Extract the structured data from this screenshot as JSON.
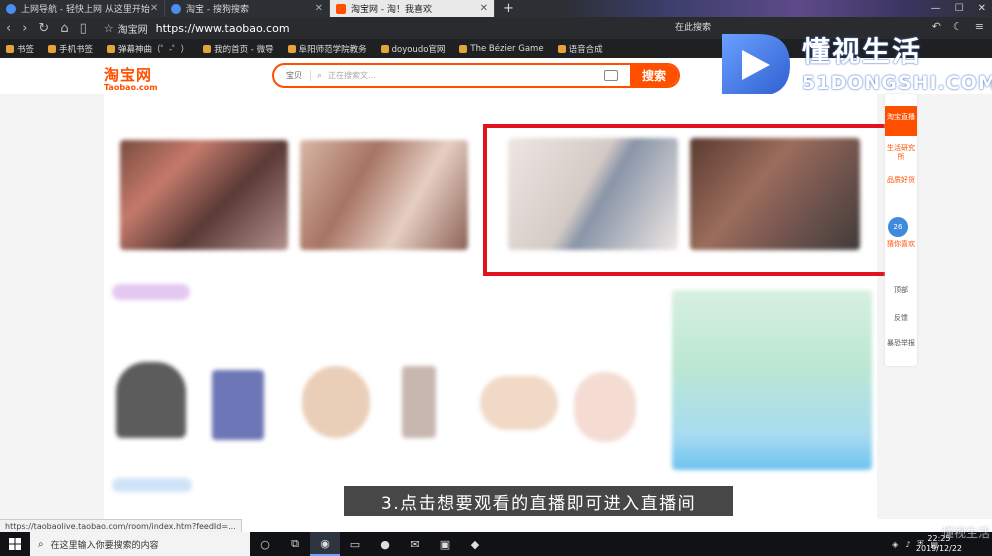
{
  "browser": {
    "tabs": [
      {
        "label": "上网导航 - 轻快上网 从这里开始",
        "active": false
      },
      {
        "label": "淘宝 - 搜狗搜索",
        "active": false
      },
      {
        "label": "淘宝网 - 淘！我喜欢",
        "active": true
      }
    ],
    "new_tab": "+",
    "site_label": "淘宝网",
    "url": "https://www.taobao.com",
    "search_button": "在此搜索",
    "bookmarks": [
      "书签",
      "手机书签",
      "弹幕神曲（゜-゜）",
      "我的首页 - 微导",
      "阜阳师范学院教务",
      "doyoudo官网",
      "The Bézier Game",
      "语音合成"
    ]
  },
  "taobao": {
    "logo_cn": "淘宝网",
    "logo_en": "Taobao.com",
    "search": {
      "category": "宝贝",
      "placeholder": "正在搜索文...",
      "button": "搜索"
    }
  },
  "sidebar": {
    "live": "淘宝直播",
    "items": [
      "生活研究所",
      "品质好货",
      "猜你喜欢",
      "顶部",
      "反馈",
      "暴恐举报"
    ],
    "badge": "26"
  },
  "watermark": {
    "title": "懂视生活",
    "domain": "51DONGSHI.COM"
  },
  "subtitle": "3.点击想要观看的直播即可进入直播间",
  "status_url": "https://taobaolive.taobao.com/room/index.htm?feedId=...",
  "taskbar": {
    "search_placeholder": "在这里输入你要搜索的内容",
    "time": "22:25",
    "date": "2019/12/22"
  },
  "colors": {
    "taobao_orange": "#ff5000",
    "highlight_red": "#e0141c",
    "browser_dark": "#2a2b2e"
  }
}
